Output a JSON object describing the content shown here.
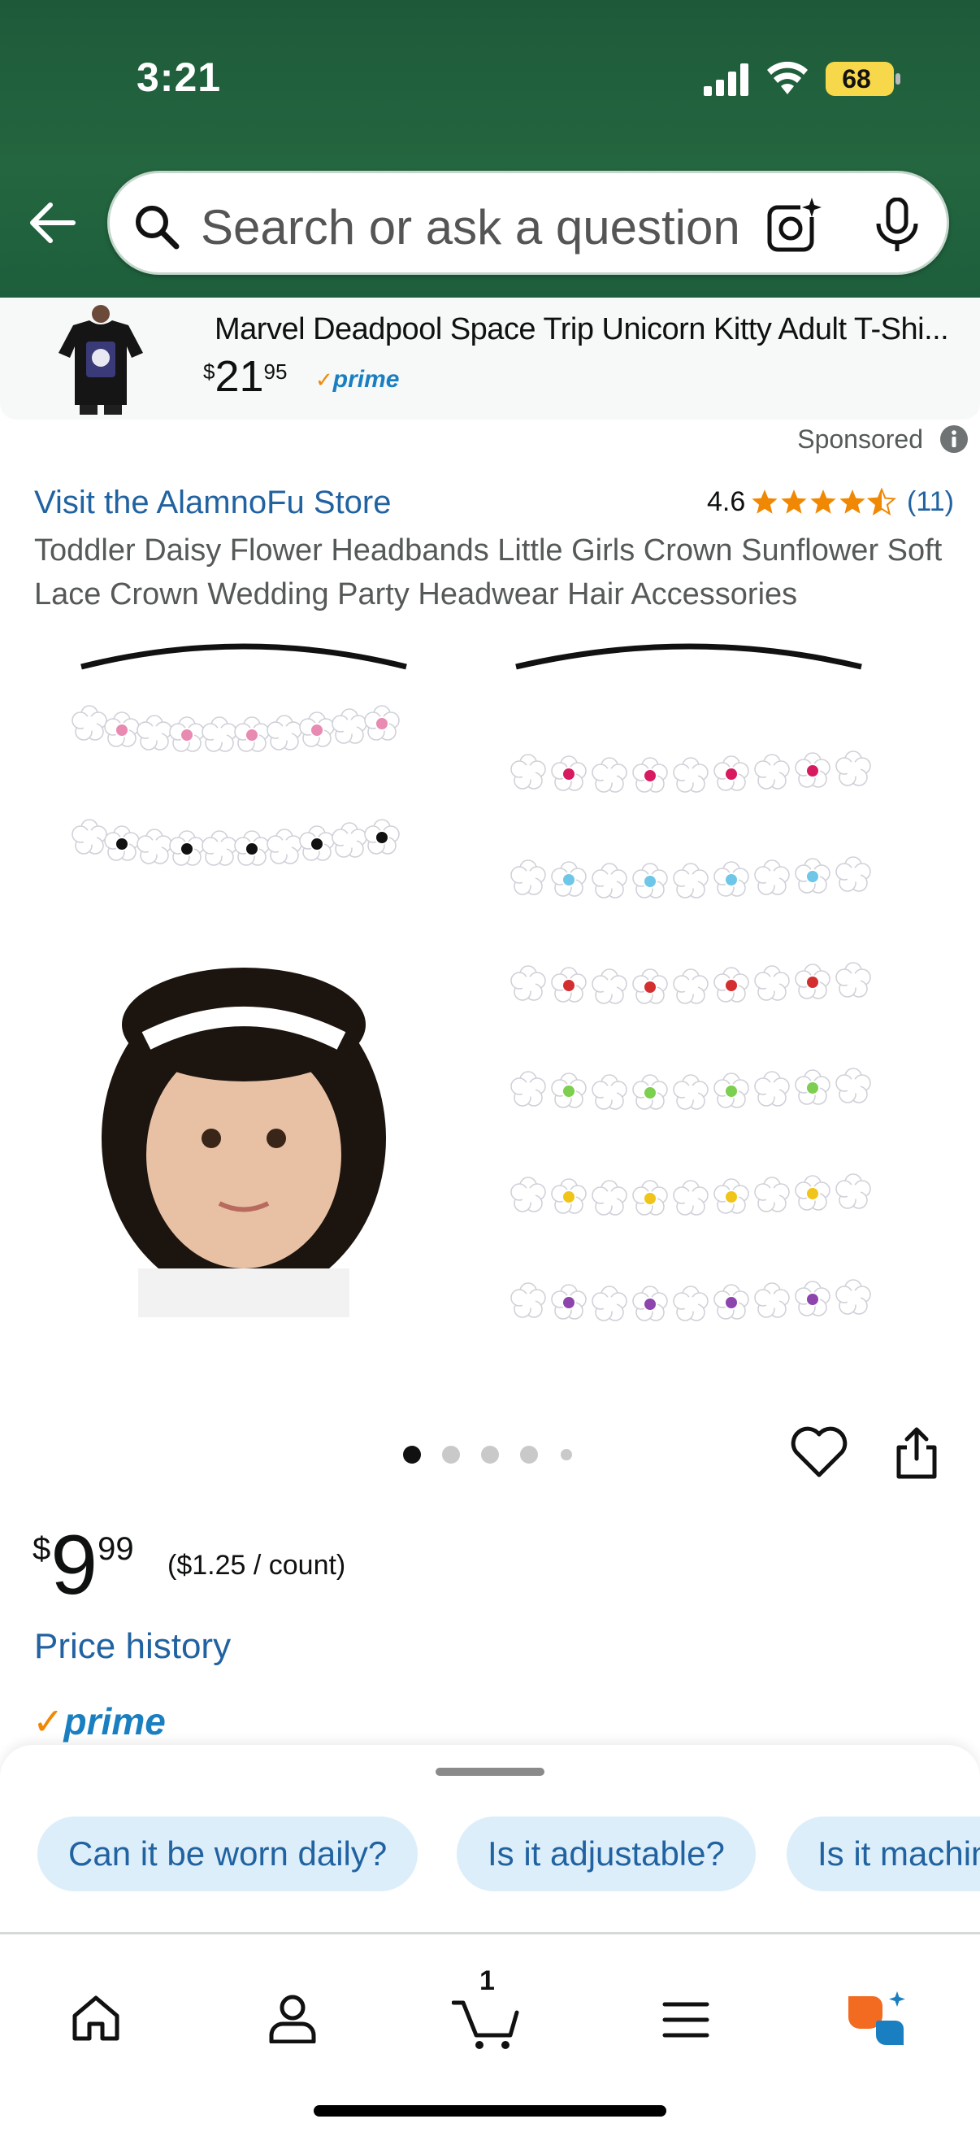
{
  "status_bar": {
    "time": "3:21",
    "battery": "68"
  },
  "search": {
    "placeholder": "Search or ask a question"
  },
  "sponsored_banner": {
    "title": "Marvel Deadpool Space Trip Unicorn Kitty Adult T-Shi...",
    "price_symbol": "$",
    "price_whole": "21",
    "price_fraction": "95",
    "prime_label": "prime",
    "sponsored_label": "Sponsored"
  },
  "product": {
    "store_link": "Visit the AlamnoFu Store",
    "rating": "4.6",
    "stars": 4.5,
    "rating_count": "(11)",
    "title": "Toddler Daisy Flower Headbands Little Girls Crown Sunflower Soft Lace Crown Wedding Party Headwear Hair Accessories",
    "gallery": {
      "image_count": 5,
      "active_index": 0
    },
    "price_symbol": "$",
    "price_whole": "9",
    "price_fraction": "99",
    "unit_price": "($1.25 / count)",
    "price_history": "Price history",
    "prime_label": "prime"
  },
  "suggestions": [
    {
      "label": "Can it be worn daily?"
    },
    {
      "label": "Is it adjustable?"
    },
    {
      "label": "Is it machine washable?"
    }
  ],
  "bottom_nav": {
    "items": [
      "home-icon",
      "account-icon",
      "cart-icon",
      "menu-icon",
      "rufus-icon"
    ],
    "cart_count": "1"
  },
  "colors": {
    "header_green": "#24663f",
    "link_blue": "#2162a1",
    "prime_blue": "#1a7fc1",
    "prime_check_orange": "#f08804",
    "star_orange": "#f08804",
    "chip_bg": "#dceefa",
    "battery_yellow": "#f7d84a"
  }
}
